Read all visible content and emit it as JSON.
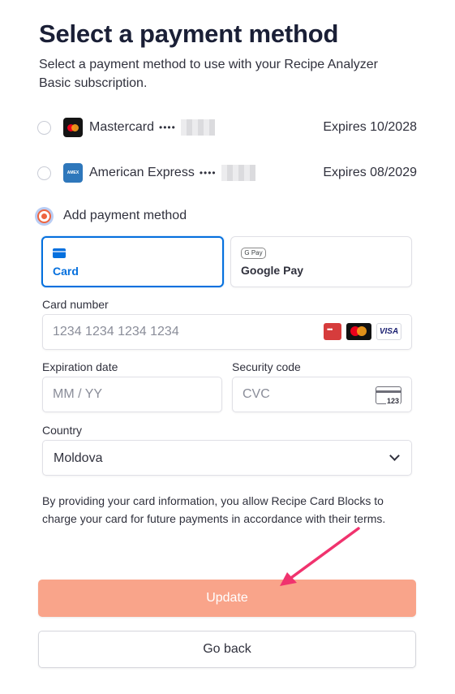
{
  "page": {
    "title": "Select a payment method",
    "subtitle": "Select a payment method to use with your Recipe Analyzer Basic subscription."
  },
  "saved_methods": [
    {
      "brand": "Mastercard",
      "dots": "••••",
      "expiry": "Expires 10/2028",
      "logo": "mastercard-logo"
    },
    {
      "brand": "American Express",
      "dots": "••••",
      "expiry": "Expires 08/2029",
      "logo": "amex-logo"
    }
  ],
  "add_method": {
    "label": "Add payment method",
    "selected": true
  },
  "tabs": [
    {
      "label": "Card",
      "icon": "card-icon",
      "active": true
    },
    {
      "label": "Google Pay",
      "icon": "google-pay-icon",
      "active": false
    }
  ],
  "form": {
    "card_number": {
      "label": "Card number",
      "placeholder": "1234 1234 1234 1234",
      "brands": [
        "unionpay",
        "mastercard",
        "visa"
      ],
      "visa_text": "VISA"
    },
    "expiration": {
      "label": "Expiration date",
      "placeholder": "MM / YY"
    },
    "security": {
      "label": "Security code",
      "placeholder": "CVC",
      "icon_text": "123"
    },
    "country": {
      "label": "Country",
      "value": "Moldova"
    }
  },
  "legal_text": "By providing your card information, you allow Recipe Card Blocks to charge your card for future payments in accordance with their terms.",
  "buttons": {
    "update": "Update",
    "go_back": "Go back"
  },
  "icons": {
    "gpay_text": "G Pay",
    "amex_text": "AMEX"
  },
  "colors": {
    "accent": "#0570de",
    "update_button": "#f9a48a",
    "radio_selected": "#ee6540",
    "annotation_arrow": "#f0336e"
  }
}
